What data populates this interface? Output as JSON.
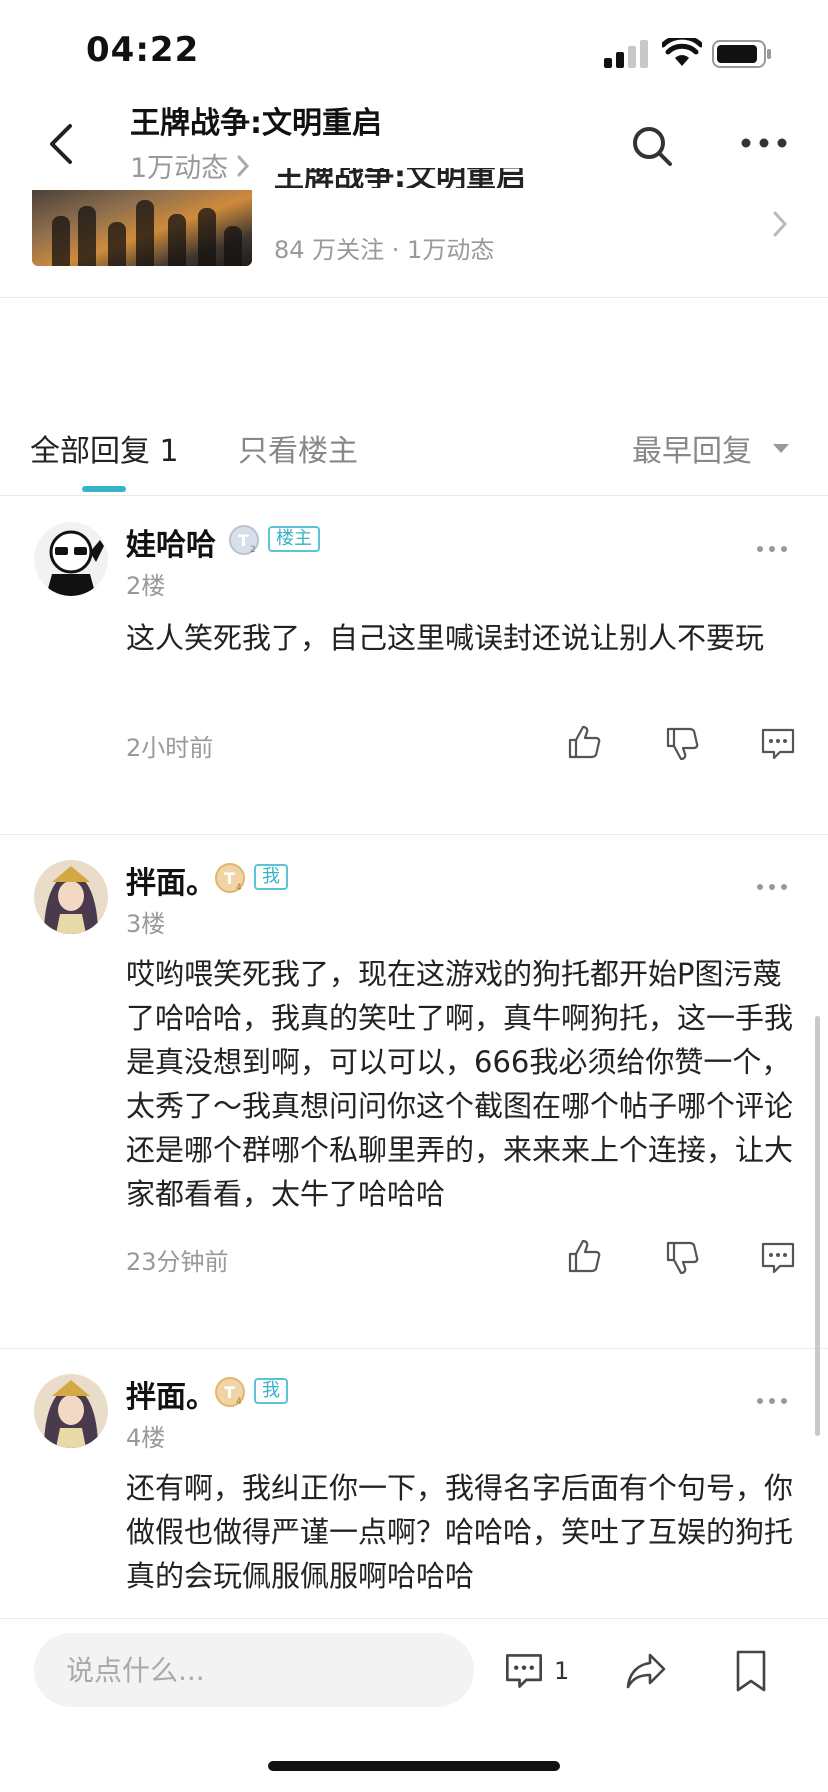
{
  "status": {
    "time": "04:22"
  },
  "nav": {
    "title": "王牌战争:文明重启",
    "subtitle": "1万动态"
  },
  "game_card": {
    "stats": "84 万关注 · 1万动态"
  },
  "tabs": {
    "all_label": "全部回复",
    "all_count": "1",
    "owner_only": "只看楼主",
    "sort_label": "最早回复"
  },
  "posts": [
    {
      "username": "娃哈哈",
      "tag": "楼主",
      "floor": "2楼",
      "content": "这人笑死我了，自己这里喊误封还说让别人不要玩",
      "time": "2小时前"
    },
    {
      "username": "拌面。",
      "tag": "我",
      "floor": "3楼",
      "content": "哎哟喂笑死我了，现在这游戏的狗托都开始P图污蔑了哈哈哈，我真的笑吐了啊，真牛啊狗托，这一手我是真没想到啊，可以可以，666我必须给你赞一个，太秀了～我真想问问你这个截图在哪个帖子哪个评论还是哪个群哪个私聊里弄的，来来来上个连接，让大家都看看，太牛了哈哈哈",
      "time": "23分钟前"
    },
    {
      "username": "拌面。",
      "tag": "我",
      "floor": "4楼",
      "content": "还有啊，我纠正你一下，我得名字后面有个句号，你做假也做得严谨一点啊？哈哈哈，笑吐了互娱的狗托真的会玩佩服佩服啊哈哈哈"
    }
  ],
  "bottom_bar": {
    "input_placeholder": "说点什么...",
    "comment_count": "1"
  },
  "colors": {
    "accent": "#38b2c6",
    "text_primary": "#222222",
    "text_secondary": "#999999"
  }
}
